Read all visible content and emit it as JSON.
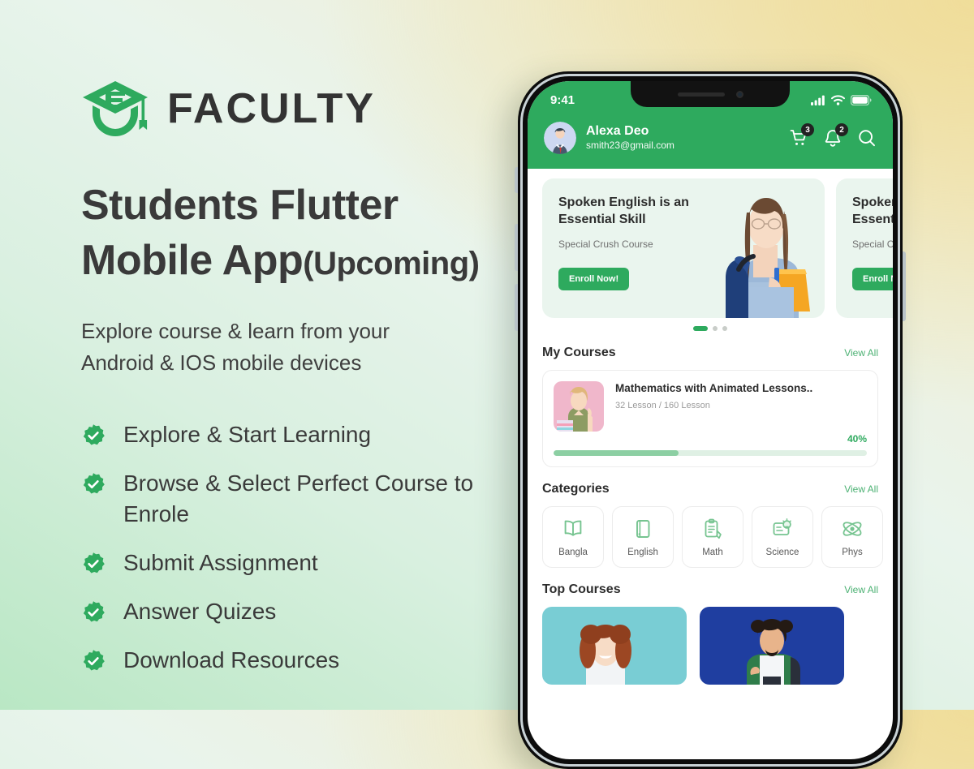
{
  "brand": {
    "name": "FACULTY",
    "logo_icon": "graduation-cap-icon",
    "accent": "#2eaa5e"
  },
  "hero": {
    "headline_line1": "Students Flutter",
    "headline_line2_main": "Mobile App",
    "headline_line2_suffix": "(Upcoming)",
    "subhead_line1": "Explore course & learn from your",
    "subhead_line2": "Android & IOS mobile devices"
  },
  "features": [
    {
      "label": "Explore & Start Learning",
      "icon": "check-badge-icon"
    },
    {
      "label": "Browse & Select Perfect Course to Enrole",
      "icon": "check-badge-icon"
    },
    {
      "label": "Submit Assignment",
      "icon": "check-badge-icon"
    },
    {
      "label": "Answer Quizes",
      "icon": "check-badge-icon"
    },
    {
      "label": "Download Resources",
      "icon": "check-badge-icon"
    }
  ],
  "phone": {
    "statusbar": {
      "time": "9:41",
      "signal_icon": "cellular-signal-icon",
      "wifi_icon": "wifi-icon",
      "battery_icon": "battery-full-icon"
    },
    "header": {
      "avatar_icon": "user-avatar",
      "user_name": "Alexa Deo",
      "user_email": "smith23@gmail.com",
      "cart_icon": "shopping-cart-icon",
      "cart_badge": "3",
      "bell_icon": "notification-bell-icon",
      "bell_badge": "2",
      "search_icon": "search-icon"
    },
    "banners": [
      {
        "title": "Spoken English is an Essential Skill",
        "subtitle": "Special Crush Course",
        "cta": "Enroll Now!"
      },
      {
        "title": "Spoken English is an Essential Skill",
        "subtitle": "Special Crush Course",
        "cta": "Enroll Now!"
      }
    ],
    "banner_dots": 3,
    "banner_active_dot": 0,
    "my_courses": {
      "title": "My Courses",
      "view_all": "View All",
      "course": {
        "title": "Mathematics with Animated Lessons..",
        "meta": "32 Lesson / 160 Lesson",
        "percent_label": "40%",
        "percent": 40
      }
    },
    "categories": {
      "title": "Categories",
      "view_all": "View All",
      "items": [
        {
          "label": "Bangla",
          "icon": "open-book-icon"
        },
        {
          "label": "English",
          "icon": "closed-book-icon"
        },
        {
          "label": "Math",
          "icon": "clipboard-pencil-icon"
        },
        {
          "label": "Science",
          "icon": "science-card-icon"
        },
        {
          "label": "Phys",
          "icon": "physics-icon"
        }
      ]
    },
    "top_courses": {
      "title": "Top Courses",
      "view_all": "View All",
      "cards": [
        {
          "image": "woman-teal-portrait"
        },
        {
          "image": "man-blue-portrait"
        }
      ]
    }
  }
}
